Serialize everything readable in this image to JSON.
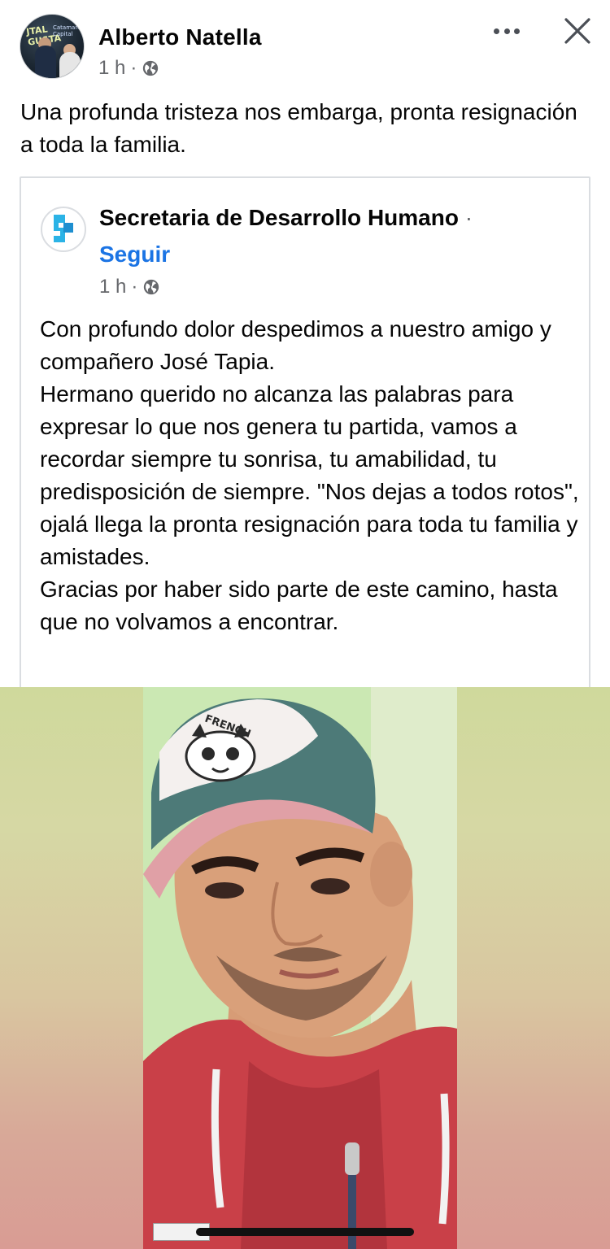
{
  "post": {
    "author_name": "Alberto Natella",
    "time": "1 h",
    "separator": "·",
    "text": "Una profunda tristeza nos embarga, pronta resignación a toda la familia."
  },
  "avatar": {
    "text_line1": "JTAL GUSTA",
    "text_line2": "Catamarca Capital"
  },
  "shared": {
    "page_name": "Secretaria de Desarrollo Humano",
    "name_separator": "·",
    "follow_label": "Seguir",
    "time": "1 h",
    "separator": "·",
    "text": "Con profundo dolor despedimos a nuestro amigo y compañero José Tapia.\nHermano querido no alcanza las palabras para expresar lo que nos genera tu partida, vamos a recordar siempre tu sonrisa, tu amabilidad, tu predisposición de siempre. \"Nos dejas a todos rotos\", ojalá llega la pronta resignación para toda tu familia y amistades.\nGracias por haber sido parte de este camino, hasta que no volvamos a encontrar."
  },
  "photo": {
    "cap_text": "FRENCH"
  },
  "icons": {
    "more": "more-horizontal-icon",
    "close": "close-icon",
    "globe": "globe-icon"
  },
  "colors": {
    "link_blue": "#1b74e4",
    "meta_gray": "#65676b",
    "text_dark": "#050505"
  }
}
